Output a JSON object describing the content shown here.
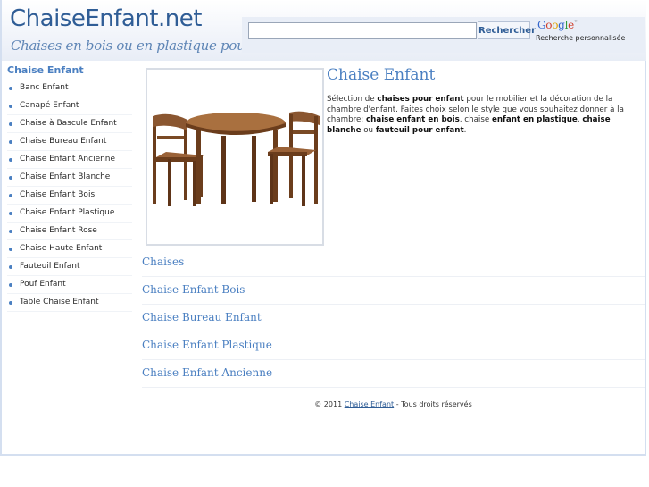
{
  "header": {
    "site_title": "ChaiseEnfant.net",
    "tagline": "Chaises en bois ou en plastique pour enfant"
  },
  "search": {
    "value": "",
    "button_label": "Rechercher",
    "provider": "Google",
    "caption": "Recherche personnalisée"
  },
  "sidebar": {
    "heading": "Chaise Enfant",
    "items": [
      {
        "label": "Banc Enfant"
      },
      {
        "label": "Canapé Enfant"
      },
      {
        "label": "Chaise à Bascule Enfant"
      },
      {
        "label": "Chaise Bureau Enfant"
      },
      {
        "label": "Chaise Enfant Ancienne"
      },
      {
        "label": "Chaise Enfant Blanche"
      },
      {
        "label": "Chaise Enfant Bois"
      },
      {
        "label": "Chaise Enfant Plastique"
      },
      {
        "label": "Chaise Enfant Rose"
      },
      {
        "label": "Chaise Haute Enfant"
      },
      {
        "label": "Fauteuil Enfant"
      },
      {
        "label": "Pouf Enfant"
      },
      {
        "label": "Table Chaise Enfant"
      }
    ]
  },
  "content": {
    "title": "Chaise Enfant",
    "intro": {
      "p1": "Sélection de ",
      "b1": "chaises pour enfant",
      "p2": " pour le mobilier et la décoration de la chambre d'enfant. Faites choix selon le style que vous souhaitez donner à la chambre: ",
      "b2": "chaise enfant en bois",
      "p3": ", chaise ",
      "b3": "enfant en plastique",
      "p4": ", ",
      "b4": "chaise blanche",
      "p5": " ou ",
      "b5": "fauteuil pour enfant",
      "p6": "."
    },
    "sections": [
      {
        "title": "Chaises"
      },
      {
        "title": "Chaise Enfant Bois"
      },
      {
        "title": "Chaise Bureau Enfant"
      },
      {
        "title": "Chaise Enfant Plastique"
      },
      {
        "title": "Chaise Enfant Ancienne"
      }
    ]
  },
  "footer": {
    "prefix": "© 2011 ",
    "link": "Chaise Enfant",
    "suffix": " - Tous droits réservés"
  },
  "colors": {
    "brand": "#2f5d96",
    "accent": "#4a7fc1",
    "wood": "#7a4a25"
  },
  "icons": {
    "bullet": "bullet-icon"
  }
}
